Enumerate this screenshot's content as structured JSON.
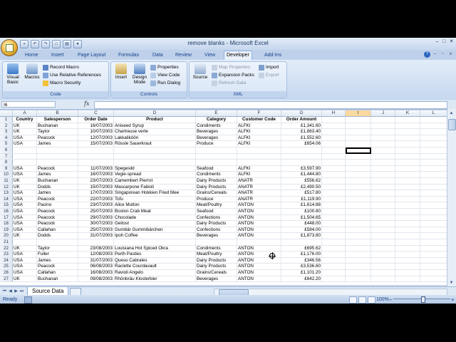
{
  "window": {
    "title": "remove blanks - Microsoft Excel",
    "accent": "#15428b"
  },
  "qat_icons": [
    "save-icon",
    "undo-icon",
    "redo-icon",
    "new-icon",
    "print-icon",
    "customize-icon"
  ],
  "tabs": [
    {
      "label": "Home",
      "active": false
    },
    {
      "label": "Insert",
      "active": false
    },
    {
      "label": "Page Layout",
      "active": false
    },
    {
      "label": "Formulas",
      "active": false
    },
    {
      "label": "Data",
      "active": false
    },
    {
      "label": "Review",
      "active": false
    },
    {
      "label": "View",
      "active": false
    },
    {
      "label": "Developer",
      "active": true
    },
    {
      "label": "Add-Ins",
      "active": false
    }
  ],
  "ribbon": {
    "code": {
      "label": "Code",
      "visual_basic": "Visual Basic",
      "macros": "Macros",
      "record_macro": "Record Macro",
      "use_relative": "Use Relative References",
      "macro_security": "Macro Security"
    },
    "controls": {
      "label": "Controls",
      "insert": "Insert",
      "design_mode": "Design Mode",
      "properties": "Properties",
      "view_code": "View Code",
      "run_dialog": "Run Dialog"
    },
    "xml": {
      "label": "XML",
      "source": "Source",
      "map_properties": "Map Properties",
      "expansion_packs": "Expansion Packs",
      "refresh_data": "Refresh Data",
      "import": "Import",
      "export": "Export"
    }
  },
  "formula_bar": {
    "name_box": "I6",
    "fx": "fx",
    "value": ""
  },
  "columns": [
    "A",
    "B",
    "C",
    "D",
    "E",
    "F",
    "G",
    "H",
    "I",
    "J",
    "K",
    "L"
  ],
  "selected_column": "I",
  "header_row": [
    "Country",
    "Salesperson",
    "Order Date",
    "Product",
    "Category",
    "Customer Code",
    "Order Amount"
  ],
  "rows": [
    {
      "n": "1",
      "header": true
    },
    {
      "n": "2",
      "cells": [
        "UK",
        "Buchanan",
        "16/07/2003",
        "Aniseed Syrup",
        "Condiments",
        "ALFKI",
        "£1,341.60"
      ]
    },
    {
      "n": "3",
      "cells": [
        "UK",
        "Taylor",
        "10/07/2003",
        "Chartreuse verte",
        "Beverages",
        "ALFKI",
        "£1,863.40"
      ]
    },
    {
      "n": "4",
      "cells": [
        "USA",
        "Peacock",
        "12/07/2003",
        "Lakkalikööri",
        "Beverages",
        "ALFKI",
        "£1,552.60"
      ]
    },
    {
      "n": "5",
      "cells": [
        "USA",
        "James",
        "15/07/2003",
        "Rössle Sauerkraut",
        "Produce",
        "ALFKI",
        "£654.06"
      ]
    },
    {
      "n": "6",
      "cells": [
        "",
        "",
        "",
        "",
        "",
        "",
        ""
      ]
    },
    {
      "n": "7",
      "cells": [
        "",
        "",
        "",
        "",
        "",
        "",
        ""
      ]
    },
    {
      "n": "8",
      "cells": [
        "",
        "",
        "",
        "",
        "",
        "",
        ""
      ]
    },
    {
      "n": "9",
      "cells": [
        "USA",
        "Peacock",
        "11/07/2003",
        "Spegesild",
        "Seafood",
        "ALFKI",
        "£3,597.90"
      ]
    },
    {
      "n": "10",
      "cells": [
        "USA",
        "James",
        "16/07/2003",
        "Vegie-spread",
        "Condiments",
        "ALFKI",
        "£1,444.80"
      ]
    },
    {
      "n": "11",
      "cells": [
        "UK",
        "Buchanan",
        "23/07/2003",
        "Camembert Pierrot",
        "Dairy Products",
        "ANATR",
        "£556.62"
      ]
    },
    {
      "n": "12",
      "cells": [
        "UK",
        "Dodds",
        "15/07/2003",
        "Mascarpone Fabioli",
        "Dairy Products",
        "ANATR",
        "£2,490.50"
      ]
    },
    {
      "n": "13",
      "cells": [
        "USA",
        "James",
        "17/07/2003",
        "Singaporean Hokkien Fried Mee",
        "Grains/Cereals",
        "ANATR",
        "£517.80"
      ]
    },
    {
      "n": "14",
      "cells": [
        "USA",
        "Peacock",
        "22/07/2003",
        "Tofu",
        "Produce",
        "ANATR",
        "£1,119.90"
      ]
    },
    {
      "n": "15",
      "cells": [
        "USA",
        "Pacino",
        "23/07/2003",
        "Alice Mutton",
        "Meat/Poultry",
        "ANTON",
        "£1,614.88"
      ]
    },
    {
      "n": "16",
      "cells": [
        "USA",
        "Peacock",
        "25/07/2003",
        "Boston Crab Meat",
        "Seafood",
        "ANTON",
        "£100.80"
      ]
    },
    {
      "n": "17",
      "cells": [
        "USA",
        "Peacock",
        "29/07/2003",
        "Chocolade",
        "Confections",
        "ANTON",
        "£1,504.65"
      ]
    },
    {
      "n": "18",
      "cells": [
        "USA",
        "Peacock",
        "30/07/2003",
        "Geitost",
        "Dairy Products",
        "ANTON",
        "£448.00"
      ]
    },
    {
      "n": "19",
      "cells": [
        "USA",
        "Callahan",
        "25/07/2003",
        "Gumbär Gummibärchen",
        "Confections",
        "ANTON",
        "£584.00"
      ]
    },
    {
      "n": "20",
      "cells": [
        "UK",
        "Dodds",
        "31/07/2003",
        "Ipoh Coffee",
        "Beverages",
        "ANTON",
        "£1,873.80"
      ]
    },
    {
      "n": "21",
      "cells": [
        "",
        "",
        "",
        "",
        "",
        "",
        ""
      ]
    },
    {
      "n": "22",
      "cells": [
        "UK",
        "Taylor",
        "23/08/2003",
        "Louisiana Hot Spiced Okra",
        "Condiments",
        "ANTON",
        "£695.62"
      ]
    },
    {
      "n": "23",
      "cells": [
        "USA",
        "Fuller",
        "12/08/2003",
        "Perth Pasties",
        "Meat/Poultry",
        "ANTON",
        "£1,176.00"
      ]
    },
    {
      "n": "24",
      "cells": [
        "USA",
        "James",
        "31/07/2003",
        "Queso Cabrales",
        "Dairy Products",
        "ANTON",
        "£346.56"
      ]
    },
    {
      "n": "25",
      "cells": [
        "USA",
        "Peacock",
        "06/08/2003",
        "Raclette Courdavault",
        "Dairy Products",
        "ANTON",
        "£3,536.60"
      ]
    },
    {
      "n": "26",
      "cells": [
        "USA",
        "Callahan",
        "16/08/2003",
        "Ravioli Angelo",
        "Grains/Cereals",
        "ANTON",
        "£1,101.20"
      ]
    },
    {
      "n": "27",
      "cells": [
        "UK",
        "Buchanan",
        "09/08/2003",
        "Rhönbräu Klosterbier",
        "Beverages",
        "ANTON",
        "£642.20"
      ]
    }
  ],
  "sheet_tab": "Source Data",
  "status": {
    "ready": "Ready",
    "zoom": "100%"
  }
}
